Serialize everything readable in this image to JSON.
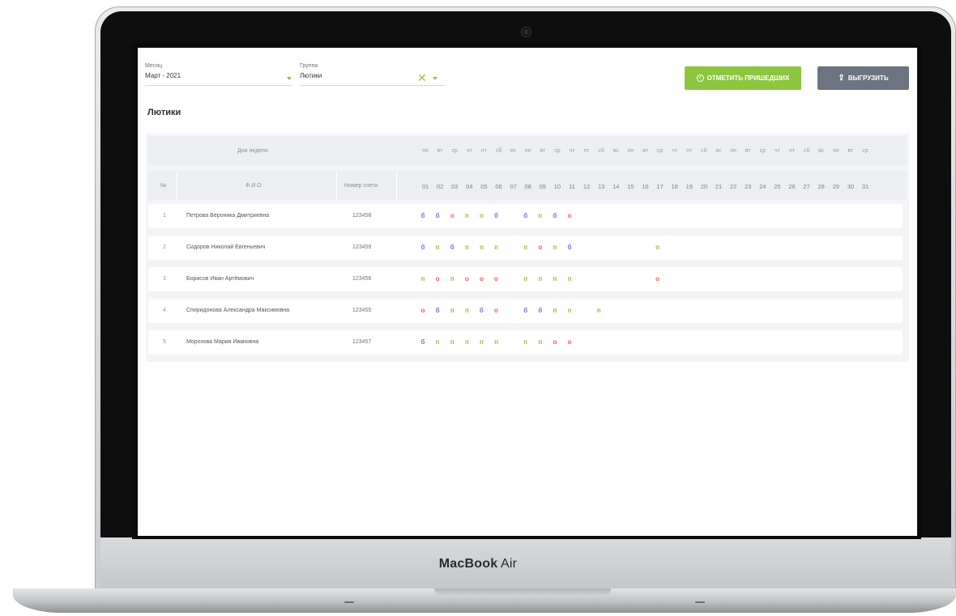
{
  "device": {
    "brand_bold": "MacBook",
    "brand_light": " Air"
  },
  "filters": {
    "month": {
      "label": "Месяц",
      "value": "Март - 2021"
    },
    "group": {
      "label": "Группа",
      "value": "Лютики"
    }
  },
  "buttons": {
    "mark_present": "ОТМЕТИТЬ ПРИШЕДШИХ",
    "export": "ВЫГРУЗИТЬ"
  },
  "group_title": "Лютики",
  "table": {
    "weekday_header": "Дни недели",
    "col_no": "№",
    "col_name": "Ф.И.О",
    "col_account": "Номер счета",
    "weekdays": [
      "пн",
      "вт",
      "ср",
      "чт",
      "пт",
      "сб",
      "вс",
      "пн",
      "вт",
      "ср",
      "чт",
      "пт",
      "сб",
      "вс",
      "пн",
      "вт",
      "ср",
      "чт",
      "пт",
      "сб",
      "вс",
      "пн",
      "вт",
      "ср",
      "чт",
      "пт",
      "сб",
      "вс",
      "пн",
      "вт",
      "ср"
    ],
    "days": [
      "01",
      "02",
      "03",
      "04",
      "05",
      "06",
      "07",
      "08",
      "09",
      "10",
      "11",
      "12",
      "13",
      "14",
      "15",
      "16",
      "17",
      "18",
      "19",
      "20",
      "21",
      "22",
      "23",
      "24",
      "25",
      "26",
      "27",
      "28",
      "29",
      "30",
      "31"
    ],
    "rows": [
      {
        "n": "1",
        "name": "Петрова Вероника Дмитриевна",
        "account": "123458",
        "marks": [
          "б",
          "б",
          "о",
          "п",
          "п",
          "б",
          "",
          "б",
          "п",
          "б",
          "о",
          "",
          "",
          "",
          "",
          "",
          "",
          "",
          "",
          "",
          "",
          "",
          "",
          "",
          "",
          "",
          "",
          "",
          "",
          "",
          ""
        ]
      },
      {
        "n": "2",
        "name": "Сидоров Николай Евгеньевич",
        "account": "123459",
        "marks": [
          "б",
          "п",
          "б",
          "п",
          "п",
          "п",
          "",
          "п",
          "о",
          "п",
          "б",
          "",
          "",
          "",
          "",
          "",
          "п",
          "",
          "",
          "",
          "",
          "",
          "",
          "",
          "",
          "",
          "",
          "",
          "",
          "",
          ""
        ]
      },
      {
        "n": "3",
        "name": "Борисов Иван Артёмович",
        "account": "123456",
        "marks": [
          "п",
          "о",
          "п",
          "о",
          "о",
          "о",
          "",
          "п",
          "п",
          "п",
          "п",
          "",
          "",
          "",
          "",
          "",
          "о",
          "",
          "",
          "",
          "",
          "",
          "",
          "",
          "",
          "",
          "",
          "",
          "",
          "",
          ""
        ]
      },
      {
        "n": "4",
        "name": "Спиридонова Александра Максимовна",
        "account": "123455",
        "marks": [
          "о",
          "б",
          "п",
          "п",
          "б",
          "о",
          "",
          "б",
          "б",
          "п",
          "п",
          "",
          "п",
          "",
          "",
          "",
          "",
          "",
          "",
          "",
          "",
          "",
          "",
          "",
          "",
          "",
          "",
          "",
          "",
          "",
          ""
        ]
      },
      {
        "n": "5",
        "name": "Морозова Мария Ивановна",
        "account": "123457",
        "marks": [
          "б",
          "п",
          "п",
          "п",
          "п",
          "п",
          "",
          "п",
          "п",
          "о",
          "о",
          "",
          "",
          "",
          "",
          "",
          "",
          "",
          "",
          "",
          "",
          "",
          "",
          "",
          "",
          "",
          "",
          "",
          "",
          "",
          ""
        ]
      }
    ]
  },
  "colors": {
    "accent": "#8cc63f",
    "absent": "#f05a5a",
    "sick": "#7c6fd6",
    "export_button": "#6d7481"
  }
}
